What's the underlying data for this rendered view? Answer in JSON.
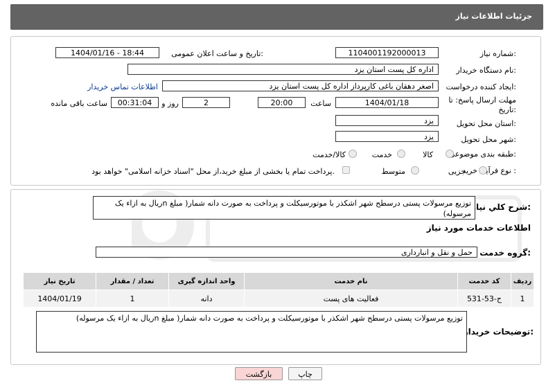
{
  "header": {
    "title": "جزئیات اطلاعات نیاز"
  },
  "fields": {
    "need_number_label": "شماره نیاز:",
    "need_number": "1104001192000013",
    "announce_label": "تاریخ و ساعت اعلان عمومی:",
    "announce_value": "1404/01/16 - 18:44",
    "buyer_label": "نام دستگاه خریدار:",
    "buyer_value": "اداره کل پست استان یزد",
    "creator_label": "ایجاد کننده درخواست:",
    "creator_value": "اصغر دهقان باغی کارپرداز اداره کل پست استان یزد",
    "contact_link": "اطلاعات تماس خریدار",
    "deadline_label_1": "مهلت ارسال پاسخ: تا",
    "deadline_label_2": "تاریخ:",
    "deadline_date": "1404/01/18",
    "time_label": "ساعت",
    "deadline_time": "20:00",
    "days_value": "2",
    "days_label": "روز و",
    "remaining_value": "00:31:04",
    "remaining_label": "ساعت باقی مانده",
    "province_label": "استان محل تحویل:",
    "province_value": "یزد",
    "city_label": "شهر محل تحویل:",
    "city_value": "یزد",
    "category_label": "طبقه بندی موضوعی:",
    "category_options": [
      "کالا",
      "خدمت",
      "کالا/خدمت"
    ],
    "process_label": "نوع فرآیند خرید :",
    "process_options": [
      "جزیی",
      "متوسط"
    ],
    "payment_note": "پرداخت تمام یا بخشی از مبلغ خرید،از محل \"اسناد خزانه اسلامی\" خواهد بود."
  },
  "summary": {
    "label": "شرح کلي نياز:",
    "text": "توزیع مرسولات پستی درسطح شهر اشکذر با موتورسیکلت و پرداخت به صورت دانه شمار( مبلغ  nریال به ازاء یک مرسوله)"
  },
  "services": {
    "section_title": "اطلاعات خدمات مورد نياز",
    "group_label": "گروه خدمت:",
    "group_value": "حمل و نقل و انبارداری",
    "columns": [
      "ردیف",
      "کد خدمت",
      "نام خدمت",
      "واحد اندازه گیری",
      "تعداد / مقدار",
      "تاریخ نیاز"
    ],
    "rows": [
      {
        "index": "1",
        "code": "ح-53-531",
        "name": "فعالیت های پست",
        "unit": "دانه",
        "qty": "1",
        "date": "1404/01/19"
      }
    ]
  },
  "buyer_notes": {
    "label": "توضیحات خریدار:",
    "text": "توزیع مرسولات پستی درسطح شهر اشکذر با موتورسیکلت و پرداخت به صورت دانه شمار( مبلغ  nریال به ازاء یک مرسوله)"
  },
  "buttons": {
    "print": "چاپ",
    "back": "بازگشت"
  },
  "colors": {
    "header_bg": "#636363",
    "back_button_bg": "#f9d5d5",
    "link": "#0b3d91"
  }
}
